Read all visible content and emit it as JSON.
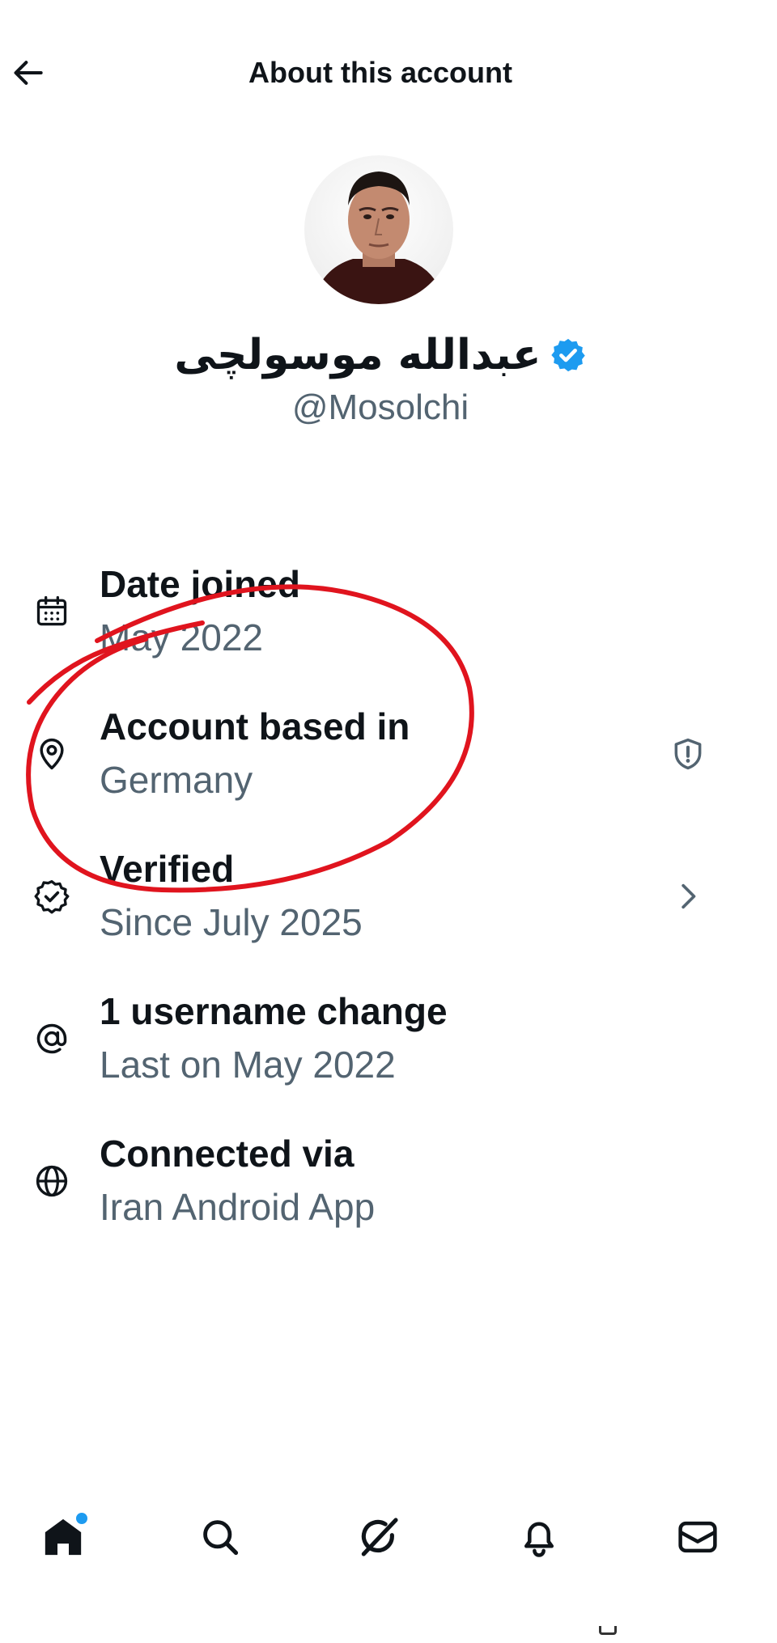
{
  "header": {
    "title": "About this account",
    "back_icon": "arrow-left-icon"
  },
  "profile": {
    "display_name": "عبدالله موسولچی",
    "handle": "@Mosolchi",
    "verified_badge_color": "#1d9bf0"
  },
  "info": [
    {
      "key": "date_joined",
      "title": "Date joined",
      "value": "May 2022",
      "icon": "calendar-icon"
    },
    {
      "key": "account_based_in",
      "title": "Account based in",
      "value": "Germany",
      "icon": "location-pin-icon",
      "trailing_icon": "shield-alert-icon"
    },
    {
      "key": "verified",
      "title": "Verified",
      "value": "Since July 2025",
      "icon": "verified-seal-icon",
      "trailing_icon": "chevron-right-icon"
    },
    {
      "key": "username_change",
      "title": "1 username change",
      "value": "Last on May 2022",
      "icon": "at-sign-icon"
    },
    {
      "key": "connected_via",
      "title": "Connected via",
      "value": "Iran Android App",
      "icon": "globe-icon"
    }
  ],
  "annotation": {
    "color": "#e0141e",
    "description_kind": "hand-drawn red circle around Account based in"
  },
  "bottom_nav": [
    {
      "name": "home",
      "icon": "home-icon",
      "active": true,
      "notification_dot": true
    },
    {
      "name": "search",
      "icon": "search-icon"
    },
    {
      "name": "grok",
      "icon": "grok-icon"
    },
    {
      "name": "notifications",
      "icon": "bell-icon"
    },
    {
      "name": "messages",
      "icon": "envelope-icon"
    }
  ],
  "colors": {
    "text_primary": "#0f1419",
    "text_secondary": "#536471",
    "accent": "#1d9bf0"
  }
}
